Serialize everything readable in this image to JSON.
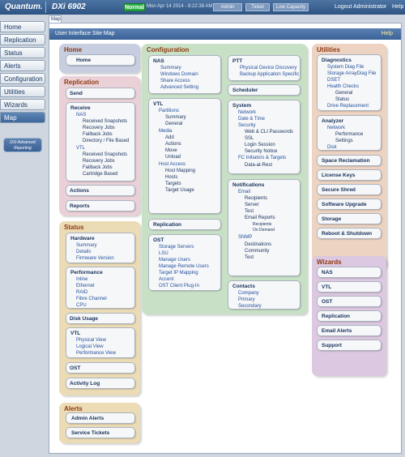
{
  "brand": "Quantum.",
  "product": "DXi 6902",
  "status": "Normal",
  "datetime": "Mon Apr 14 2014 - 8:22:38 AM PDT",
  "top_buttons": [
    "Admin",
    "Ticket",
    "Low Capacity"
  ],
  "logout": "Logout",
  "user": "Administrator",
  "help": "Help",
  "nav": [
    "Home",
    "Replication",
    "Status",
    "Alerts",
    "Configuration",
    "Utilities",
    "Wizards",
    "Map"
  ],
  "dxi_advanced": [
    "DXi Advanced",
    "Reporting"
  ],
  "map_tab": "Map",
  "header": "User Interface Site Map",
  "header_help": "Help",
  "home": {
    "title": "Home",
    "item": "Home"
  },
  "replication": {
    "title": "Replication",
    "send": "Send",
    "receive": "Receive",
    "nas": "NAS",
    "nas_items": [
      "Received Snapshots",
      "Recovery Jobs",
      "Failback Jobs",
      "Directory / File Based"
    ],
    "vtl": "VTL",
    "vtl_items": [
      "Received Snapshots",
      "Recovery Jobs",
      "Failback Jobs",
      "Cartridge Based"
    ],
    "actions": "Actions",
    "reports": "Reports"
  },
  "status_panel": {
    "title": "Status",
    "hardware": "Hardware",
    "hw_items": [
      "Summary",
      "Details",
      "Firmware Version"
    ],
    "performance": "Performance",
    "perf_items": [
      "Inline",
      "Ethernet",
      "RAID",
      "Fibre Channel",
      "CPU"
    ],
    "disk": "Disk Usage",
    "vtl": "VTL",
    "vtl_items": [
      "Physical View",
      "Logical View",
      "Performance View"
    ],
    "ost": "OST",
    "activity": "Activity Log"
  },
  "alerts_panel": {
    "title": "Alerts",
    "items": [
      "Admin Alerts",
      "Service Tickets"
    ]
  },
  "configuration": {
    "title": "Configuration",
    "nas": "NAS",
    "nas_items": [
      "Summary",
      "Windows Domain",
      "Share Access",
      "Advanced Setting"
    ],
    "vtl": "VTL",
    "vtl_partitions": "Partitions",
    "vtl_part_items": [
      "Summary",
      "General"
    ],
    "vtl_media": "Media",
    "vtl_media_items": [
      "Add",
      "Actions",
      "Move",
      "Unload"
    ],
    "vtl_host": "Host Access",
    "vtl_host_items": [
      "Host Mapping",
      "Hosts",
      "Targets",
      "Target Usage"
    ],
    "replication": "Replication",
    "ost": "OST",
    "ost_items": [
      "Storage Servers",
      "LSU",
      "Manage Users",
      "Manage Remote Users",
      "Target IP Mapping",
      "Accent",
      "OST Client Plug-In"
    ],
    "ptt": "PTT",
    "ptt_items": [
      "Physical Device Discovery",
      "Backup Application Specific"
    ],
    "scheduler": "Scheduler",
    "system": "System",
    "sys_items": [
      "Network",
      "Date & Time",
      "Security"
    ],
    "sec_items": [
      "Web & CLI Passwords",
      "SSL",
      "Login Session",
      "Security Notice"
    ],
    "sys_fc": "FC Initiators & Targets",
    "sys_fc_sub": "Data-at-Rest",
    "notifications": "Notifications",
    "email": "Email",
    "email_items": [
      "Recipients",
      "Server",
      "Test",
      "Email Reports"
    ],
    "email_report_items": [
      "Recipients",
      "On Demand"
    ],
    "snmp": "SNMP",
    "snmp_items": [
      "Destinations",
      "Community",
      "Test"
    ],
    "contacts": "Contacts",
    "contact_items": [
      "Company",
      "Primary",
      "Secondary"
    ]
  },
  "utilities": {
    "title": "Utilities",
    "diagnostics": "Diagnostics",
    "diag_items": [
      "System Diag File",
      "Storage ArrayDiag File",
      "DSET"
    ],
    "health": "Health Checks",
    "health_items": [
      "General",
      "Status"
    ],
    "drive": "Drive Replacement",
    "analyzer": "Analyzer",
    "network": "Network",
    "net_items": [
      "Performance",
      "Settings"
    ],
    "disk": "Disk",
    "items": [
      "Space Reclamation",
      "License Keys",
      "Secure Shred",
      "Software Upgrade",
      "Storage",
      "Reboot & Shutdown"
    ]
  },
  "wizards": {
    "title": "Wizards",
    "items": [
      "NAS",
      "VTL",
      "OST",
      "Replication",
      "Email Alerts",
      "Support"
    ]
  }
}
